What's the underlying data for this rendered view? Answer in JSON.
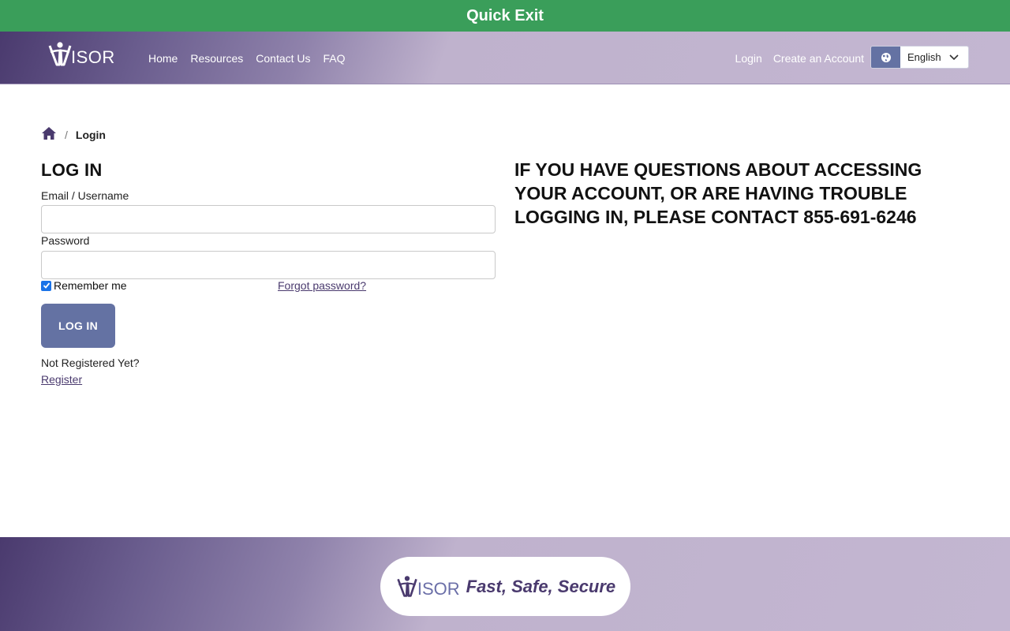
{
  "quick_exit": {
    "label": "Quick Exit"
  },
  "header": {
    "logo_text": "ISOR",
    "nav": [
      {
        "label": "Home"
      },
      {
        "label": "Resources"
      },
      {
        "label": "Contact Us"
      },
      {
        "label": "FAQ"
      }
    ],
    "login_label": "Login",
    "create_account_label": "Create an Account",
    "language": {
      "selected": "English",
      "icon": "globe-icon"
    }
  },
  "breadcrumb": {
    "home_icon": "home-icon",
    "separator": "/",
    "current": "Login"
  },
  "login_form": {
    "title": "LOG IN",
    "email_label": "Email / Username",
    "email_value": "",
    "password_label": "Password",
    "password_value": "",
    "remember_label": "Remember me",
    "remember_checked": true,
    "forgot_label": "Forgot password?",
    "submit_label": "LOG IN",
    "not_registered": "Not Registered Yet?",
    "register_label": "Register"
  },
  "help": {
    "text": "IF YOU HAVE QUESTIONS ABOUT ACCESSING YOUR ACCOUNT, OR ARE HAVING TROUBLE LOGGING IN, PLEASE CONTACT 855-691-6246"
  },
  "footer": {
    "logo_text": "ISOR",
    "tagline": "Fast, Safe, Secure"
  },
  "colors": {
    "quick_exit": "#3a9e5a",
    "brand_purple": "#4a3a6e",
    "button": "#6472a3"
  }
}
